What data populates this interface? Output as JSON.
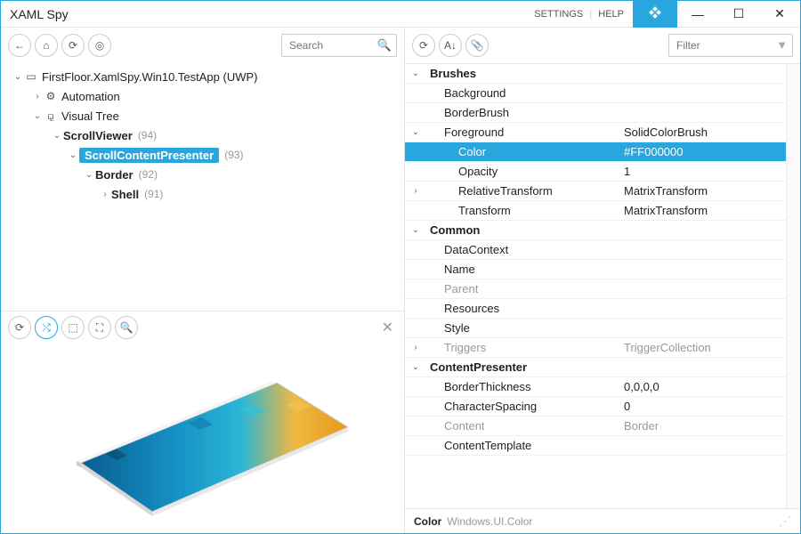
{
  "titlebar": {
    "title": "XAML Spy",
    "settings": "SETTINGS",
    "help": "HELP"
  },
  "left_toolbar": {
    "search_placeholder": "Search"
  },
  "tree": {
    "root": {
      "label": "FirstFloor.XamlSpy.Win10.TestApp (UWP)"
    },
    "automation": {
      "label": "Automation"
    },
    "visualtree": {
      "label": "Visual Tree"
    },
    "scrollviewer": {
      "label": "ScrollViewer",
      "count": "(94)"
    },
    "scp": {
      "label": "ScrollContentPresenter",
      "count": "(93)"
    },
    "border": {
      "label": "Border",
      "count": "(92)"
    },
    "shell": {
      "label": "Shell",
      "count": "(91)"
    }
  },
  "right_toolbar": {
    "filter_placeholder": "Filter"
  },
  "props": {
    "brushes": "Brushes",
    "background": "Background",
    "borderbrush": "BorderBrush",
    "foreground": {
      "name": "Foreground",
      "value": "SolidColorBrush"
    },
    "color": {
      "name": "Color",
      "value": "#FF000000"
    },
    "opacity": {
      "name": "Opacity",
      "value": "1"
    },
    "reltrans": {
      "name": "RelativeTransform",
      "value": "MatrixTransform"
    },
    "trans": {
      "name": "Transform",
      "value": "MatrixTransform"
    },
    "common": "Common",
    "datacontext": "DataContext",
    "name": "Name",
    "parent": "Parent",
    "resources": "Resources",
    "style": "Style",
    "triggers": {
      "name": "Triggers",
      "value": "TriggerCollection"
    },
    "contentpresenter": "ContentPresenter",
    "borderthickness": {
      "name": "BorderThickness",
      "value": "0,0,0,0"
    },
    "charspacing": {
      "name": "CharacterSpacing",
      "value": "0"
    },
    "content": {
      "name": "Content",
      "value": "Border"
    },
    "contenttemplate": "ContentTemplate"
  },
  "status": {
    "key": "Color",
    "type": "Windows.UI.Color"
  }
}
